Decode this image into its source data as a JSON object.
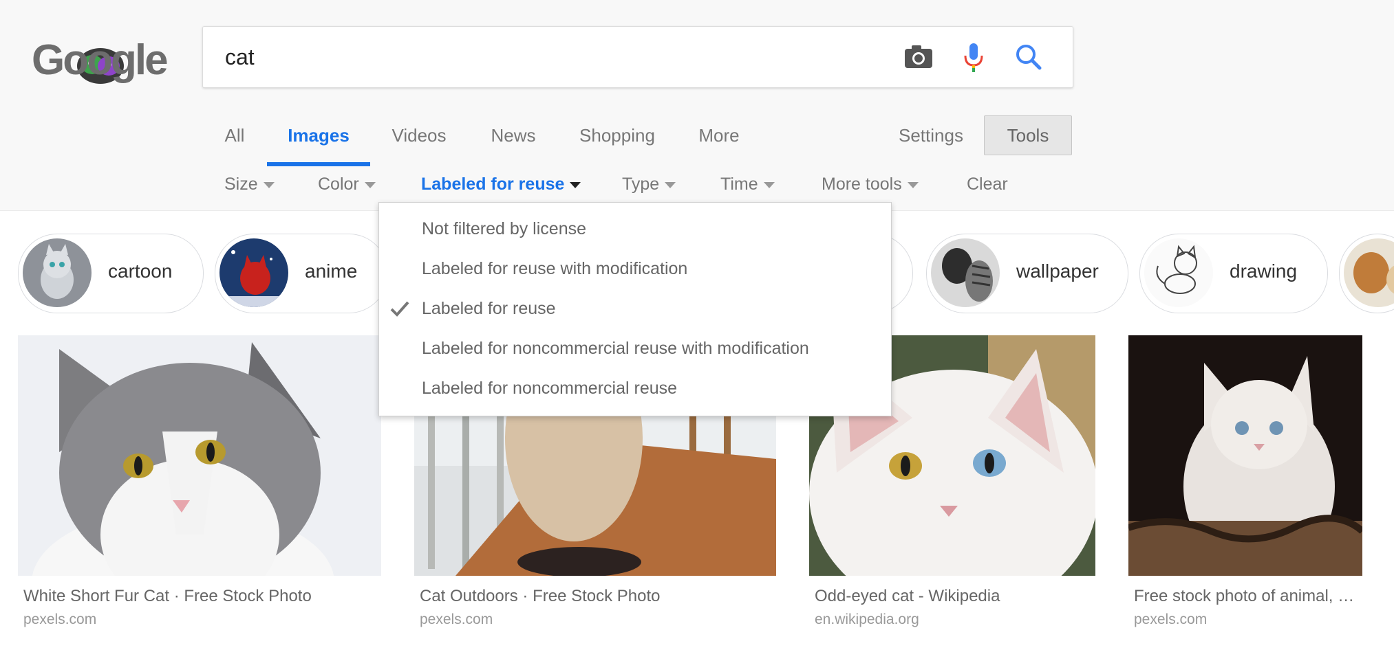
{
  "logo": {
    "text": "Google"
  },
  "search": {
    "query": "cat",
    "camera_icon": "camera-icon",
    "mic_icon": "microphone-icon",
    "search_icon": "search-icon"
  },
  "tabs": [
    {
      "label": "All"
    },
    {
      "label": "Images",
      "active": true
    },
    {
      "label": "Videos"
    },
    {
      "label": "News"
    },
    {
      "label": "Shopping"
    },
    {
      "label": "More"
    }
  ],
  "settings_label": "Settings",
  "tools_label": "Tools",
  "toolbar": {
    "size": "Size",
    "color": "Color",
    "usage_rights": "Labeled for reuse",
    "type": "Type",
    "time": "Time",
    "more_tools": "More tools",
    "clear": "Clear"
  },
  "usage_dropdown": {
    "items": [
      {
        "label": "Not filtered by license",
        "checked": false
      },
      {
        "label": "Labeled for reuse with modification",
        "checked": false
      },
      {
        "label": "Labeled for reuse",
        "checked": true
      },
      {
        "label": "Labeled for noncommercial reuse with modification",
        "checked": false
      },
      {
        "label": "Labeled for noncommercial reuse",
        "checked": false
      }
    ]
  },
  "chips": [
    {
      "label": "cartoon"
    },
    {
      "label": "anime"
    },
    {
      "label": "wallpaper"
    },
    {
      "label": "drawing"
    }
  ],
  "results": [
    {
      "title": "White Short Fur Cat · Free Stock Photo",
      "source": "pexels.com"
    },
    {
      "title": "Cat Outdoors · Free Stock Photo",
      "source": "pexels.com"
    },
    {
      "title": "Odd-eyed cat - Wikipedia",
      "source": "en.wikipedia.org"
    },
    {
      "title": "Free stock photo of animal, …",
      "source": "pexels.com"
    }
  ],
  "colors": {
    "accent": "#1a73e8",
    "topbar_bg": "#f8f8f8",
    "text_muted": "#777777"
  }
}
